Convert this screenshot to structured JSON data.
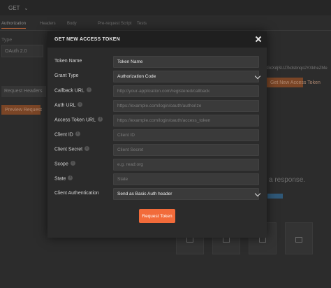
{
  "background": {
    "method": "GET",
    "tabs": [
      "Authorization",
      "Headers",
      "Body",
      "Pre-request Script",
      "Tests"
    ],
    "type_label": "Type",
    "auth_type": "OAuth 2.0",
    "request_headers_label": "Request Headers",
    "preview_label": "Preview Request",
    "get_token_label": "Get New Access Token",
    "token_fragment": "GcXdjSUJ7kdsbnqo2YXkheZMe",
    "response_hint": "a response."
  },
  "modal": {
    "title": "GET NEW ACCESS TOKEN",
    "fields": [
      {
        "label": "Token Name",
        "info": false,
        "kind": "input",
        "value": "Token Name",
        "placeholder": ""
      },
      {
        "label": "Grant Type",
        "info": false,
        "kind": "select",
        "value": "Authorization Code",
        "placeholder": ""
      },
      {
        "label": "Callback URL",
        "info": true,
        "kind": "input",
        "value": "",
        "placeholder": "http://your-application.com/registered/callback"
      },
      {
        "label": "Auth URL",
        "info": true,
        "kind": "input",
        "value": "",
        "placeholder": "https://example.com/login/oauth/authorize"
      },
      {
        "label": "Access Token URL",
        "info": true,
        "kind": "input",
        "value": "",
        "placeholder": "https://example.com/login/oauth/access_token"
      },
      {
        "label": "Client ID",
        "info": true,
        "kind": "input",
        "value": "",
        "placeholder": "Client ID"
      },
      {
        "label": "Client Secret",
        "info": true,
        "kind": "input",
        "value": "",
        "placeholder": "Client Secret"
      },
      {
        "label": "Scope",
        "info": true,
        "kind": "input",
        "value": "",
        "placeholder": "e.g. read:org"
      },
      {
        "label": "State",
        "info": true,
        "kind": "input",
        "value": "",
        "placeholder": "State"
      },
      {
        "label": "Client Authentication",
        "info": false,
        "kind": "select",
        "value": "Send as Basic Auth header",
        "placeholder": ""
      }
    ],
    "request_button": "Request Token",
    "info_glyph": "i"
  },
  "colors": {
    "accent": "#f26b3a",
    "modal_bg": "#2b2b2b",
    "header_bg": "#1f1f1f"
  }
}
